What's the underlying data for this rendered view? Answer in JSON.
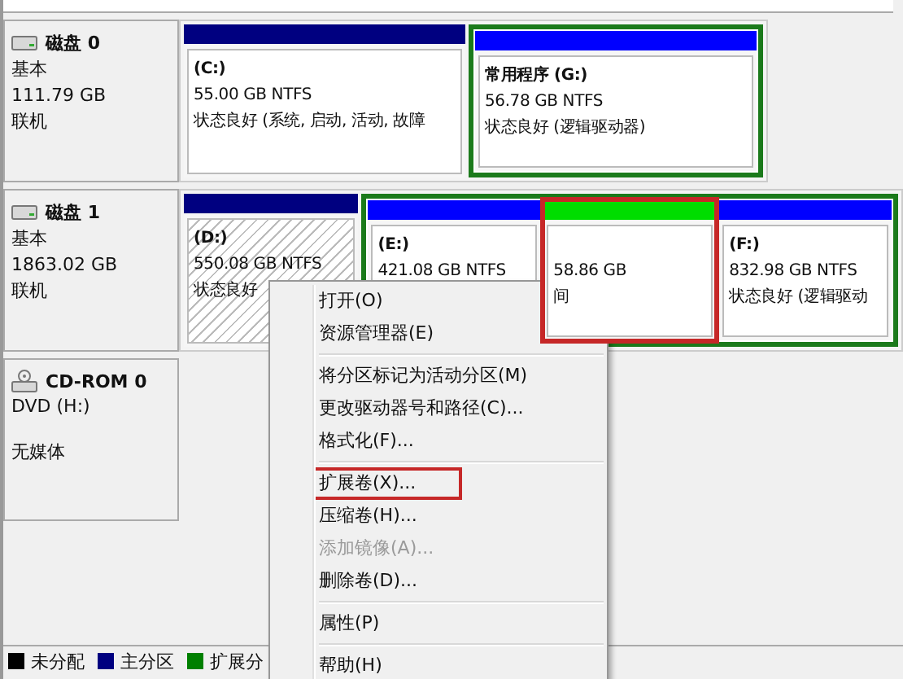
{
  "disks": [
    {
      "name": "磁盘 0",
      "kind": "disk",
      "type": "基本",
      "size": "111.79 GB",
      "status": "联机",
      "partitions": [
        {
          "kind": "primary",
          "label": "(C:)",
          "size": "55.00 GB NTFS",
          "status": "状态良好 (系统, 启动, 活动, 故障",
          "selected": false,
          "highlighted": false
        },
        {
          "kind": "extended",
          "children": [
            {
              "kind": "logical",
              "label": "常用程序  (G:)",
              "size": "56.78 GB NTFS",
              "status": "状态良好 (逻辑驱动器)",
              "selected": false,
              "highlighted": false
            }
          ]
        }
      ]
    },
    {
      "name": "磁盘 1",
      "kind": "disk",
      "type": "基本",
      "size": "1863.02 GB",
      "status": "联机",
      "partitions": [
        {
          "kind": "primary",
          "label": "(D:)",
          "size": "550.08 GB NTFS",
          "status": "状态良好",
          "selected": true,
          "highlighted": false
        },
        {
          "kind": "extended",
          "children": [
            {
              "kind": "logical",
              "label": "(E:)",
              "size": "421.08 GB NTFS",
              "selected": false,
              "highlighted": false
            },
            {
              "kind": "free",
              "size": "58.86 GB",
              "status": "间",
              "selected": false,
              "highlighted": true
            },
            {
              "kind": "logical",
              "label": "(F:)",
              "size": "832.98 GB NTFS",
              "status": "状态良好 (逻辑驱动",
              "selected": false,
              "highlighted": false
            }
          ]
        }
      ]
    },
    {
      "name": "CD-ROM 0",
      "kind": "cdrom",
      "type": "DVD (H:)",
      "status": "无媒体"
    }
  ],
  "context_menu": {
    "groups": [
      [
        {
          "label": "打开(O)",
          "disabled": false,
          "highlighted": false
        },
        {
          "label": "资源管理器(E)",
          "disabled": false,
          "highlighted": false
        }
      ],
      [
        {
          "label": "将分区标记为活动分区(M)",
          "disabled": false,
          "highlighted": false
        },
        {
          "label": "更改驱动器号和路径(C)...",
          "disabled": false,
          "highlighted": false
        },
        {
          "label": "格式化(F)...",
          "disabled": false,
          "highlighted": false
        }
      ],
      [
        {
          "label": "扩展卷(X)...",
          "disabled": false,
          "highlighted": true
        },
        {
          "label": "压缩卷(H)...",
          "disabled": false,
          "highlighted": false
        },
        {
          "label": "添加镜像(A)...",
          "disabled": true,
          "highlighted": false
        },
        {
          "label": "删除卷(D)...",
          "disabled": false,
          "highlighted": false
        }
      ],
      [
        {
          "label": "属性(P)",
          "disabled": false,
          "highlighted": false
        }
      ],
      [
        {
          "label": "帮助(H)",
          "disabled": false,
          "highlighted": false
        }
      ]
    ]
  },
  "legend": [
    {
      "label": "未分配",
      "color": "#000000"
    },
    {
      "label": "主分区",
      "color": "#000080"
    },
    {
      "label": "扩展分",
      "color": "#008000"
    }
  ]
}
